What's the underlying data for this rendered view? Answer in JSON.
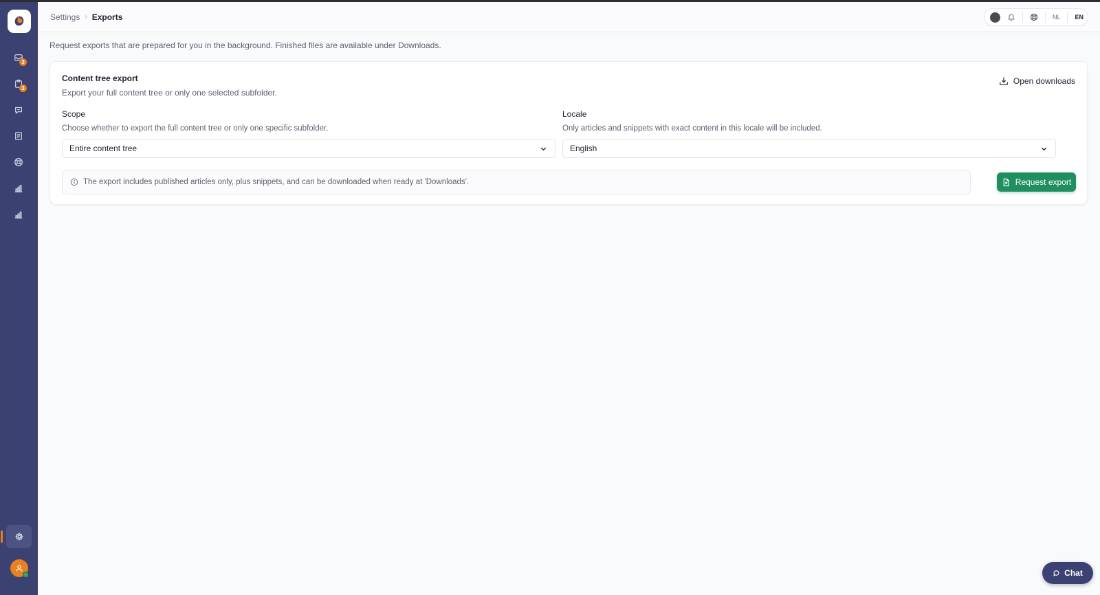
{
  "breadcrumb": {
    "parent": "Settings",
    "separator": "›",
    "current": "Exports"
  },
  "top_tools": {
    "lang_nl": "NL",
    "lang_en": "EN"
  },
  "sidebar": {
    "badges": {
      "inbox": "3",
      "tasks": "3"
    }
  },
  "intro": "Request exports that are prepared for you in the background. Finished files are available under Downloads.",
  "card": {
    "title": "Content tree export",
    "subtitle": "Export your full content tree or only one selected subfolder.",
    "open_downloads": "Open downloads",
    "scope": {
      "label": "Scope",
      "help": "Choose whether to export the full content tree or only one specific subfolder.",
      "value": "Entire content tree"
    },
    "locale": {
      "label": "Locale",
      "help": "Only articles and snippets with exact content in this locale will be included.",
      "value": "English"
    },
    "info": "The export includes published articles only, plus snippets, and can be downloaded when ready at 'Downloads'.",
    "request_button": "Request export"
  },
  "chat": {
    "label": "Chat"
  },
  "colors": {
    "sidebar": "#3b4171",
    "accent_green": "#1f8f60",
    "badge_orange": "#e67e22",
    "background": "#f9fafc"
  }
}
